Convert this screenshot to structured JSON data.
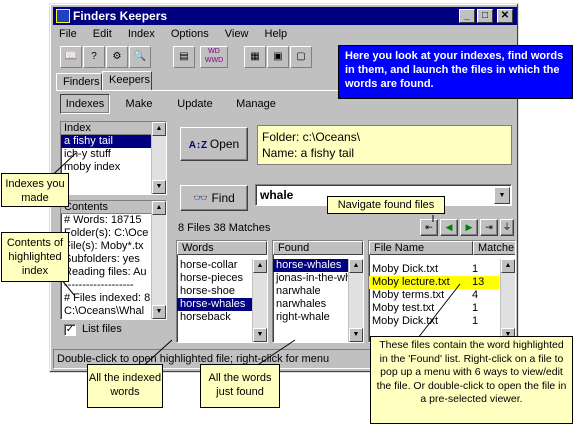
{
  "window": {
    "title": "Finders Keepers"
  },
  "menu": [
    "File",
    "Edit",
    "Index",
    "Options",
    "View",
    "Help"
  ],
  "tabs_top": [
    "Finders",
    "Keepers"
  ],
  "tabs_sub": [
    "Indexes",
    "Make",
    "Update",
    "Manage"
  ],
  "index_list": {
    "header": "Index",
    "items": [
      "a fishy tail",
      "ich-y stuff",
      "moby index"
    ],
    "selected": 0
  },
  "open_button": "Open",
  "folder_info": {
    "folder": "Folder:  c:\\Oceans\\",
    "name": "Name:  a fishy tail"
  },
  "find_button": "Find",
  "search_value": "whale",
  "contents": {
    "header": "Contents",
    "lines": [
      "# Words:  18715",
      "Folder(s):  C:\\Oce",
      "File(s):  Moby*.tx",
      "Subfolders:  yes",
      "Reading files:  Au",
      "-------------------",
      "# Files indexed:  8",
      "C:\\Oceans\\Whal"
    ]
  },
  "list_files": "List files",
  "stats": "8 Files  38 Matches",
  "words": {
    "header": "Words",
    "items": [
      "horse-collar",
      "horse-pieces",
      "horse-shoe",
      "horse-whales",
      "horseback"
    ],
    "selected": 3
  },
  "found": {
    "header": "Found",
    "items": [
      "horse-whales",
      "jonas-in-the-wh",
      "narwhale",
      "narwhales",
      "right-whale"
    ],
    "selected": 0
  },
  "files": {
    "header_name": "File Name",
    "header_matches": "Matche",
    "rows": [
      {
        "name": "Moby Dick.txt",
        "count": "1"
      },
      {
        "name": "Moby lecture.txt",
        "count": "13"
      },
      {
        "name": "Moby terms.txt",
        "count": "4"
      },
      {
        "name": "Moby test.txt",
        "count": "1"
      },
      {
        "name": "Moby Dick.txt",
        "count": "1"
      }
    ],
    "selected": 1
  },
  "status": "Double-click to open highlighted file; right-click for menu",
  "callouts": {
    "main": "Here you look at your indexes, find words in them, and launch the files in which the words are found.",
    "indexes": "Indexes you made",
    "contents": "Contents of highlighted index",
    "navigate": "Navigate found files",
    "indexed_words": "All the indexed words",
    "found_words": "All the words just found",
    "files_info": "These files contain the word highlighted in the 'Found' list. Right-click on a file to pop up a menu with 6 ways to view/edit the file.  Or double-click to open the file in a pre-selected viewer."
  },
  "colors": {
    "titlebar": "#000080",
    "callout": "#ffffc0",
    "highlight": "#000080",
    "file_highlight": "#ffff00",
    "info_box": "#0000ff"
  }
}
